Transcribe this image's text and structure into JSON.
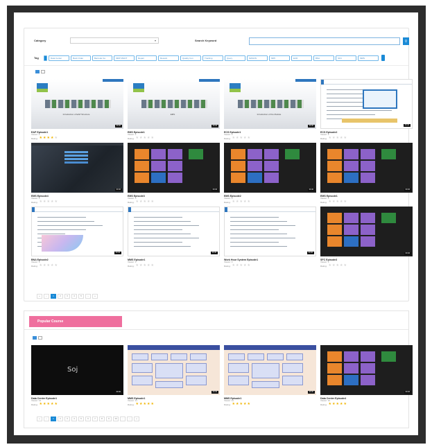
{
  "filter": {
    "category_label": "Category",
    "category_value": "",
    "search_label": "Search Keyword",
    "search_value": "",
    "tag_label": "Tag",
    "tags": [
      "Data Center",
      "Bock Order",
      "Barcode Ca",
      "MRP MGNT",
      "Repair",
      "Rework",
      "Quality Con",
      "Tracking",
      "Query",
      "MASON",
      "MPF",
      "ECR",
      "BNA",
      "SFC",
      "MMS"
    ]
  },
  "courses": [
    {
      "title": "EAP Episode1",
      "views": "Viewer: 4",
      "rating_label": "Rating:",
      "stars": 4,
      "thumb": "gallery",
      "caption": "Introduction of EAP Structure",
      "duration": "00:40"
    },
    {
      "title": "EMS Episode1",
      "views": "Viewer: 4",
      "rating_label": "Rating:",
      "stars": 0,
      "thumb": "gallery",
      "caption": "EMS",
      "duration": "00:40"
    },
    {
      "title": "ECS Episode1",
      "views": "Viewer: 3",
      "rating_label": "Rating:",
      "stars": 0,
      "thumb": "gallery",
      "caption": "Introduction of the Module",
      "duration": "00:40"
    },
    {
      "title": "ECS Episode2",
      "views": "Viewer: 3",
      "rating_label": "Rating:",
      "stars": 0,
      "thumb": "slide-diagram",
      "caption": "",
      "duration": "00:40"
    },
    {
      "title": "EMS Episode4",
      "views": "Viewer: 3",
      "rating_label": "Rating:",
      "stars": 0,
      "thumb": "dark",
      "caption": "",
      "duration": "00:40"
    },
    {
      "title": "EMS Episode3",
      "views": "Viewer: 3",
      "rating_label": "Rating:",
      "stars": 0,
      "thumb": "tiles",
      "caption": "",
      "duration": "00:40"
    },
    {
      "title": "EMS Episode2",
      "views": "Viewer: 3",
      "rating_label": "Rating:",
      "stars": 0,
      "thumb": "tiles",
      "caption": "",
      "duration": "00:40"
    },
    {
      "title": "EMS Episode1",
      "views": "Viewer: 3",
      "rating_label": "Rating:",
      "stars": 0,
      "thumb": "tiles",
      "caption": "",
      "duration": "00:40"
    },
    {
      "title": "BNA Episode2",
      "views": "Viewer: 3",
      "rating_label": "Rating:",
      "stars": 0,
      "thumb": "slide-chart",
      "caption": "",
      "duration": "00:40"
    },
    {
      "title": "MMS Episode1",
      "views": "Viewer: 3",
      "rating_label": "Rating:",
      "stars": 0,
      "thumb": "slide-text",
      "caption": "",
      "duration": "00:40"
    },
    {
      "title": "Work Hour System Episode1",
      "views": "Viewer: 3",
      "rating_label": "Rating:",
      "stars": 0,
      "thumb": "slide-text",
      "caption": "",
      "duration": "00:40"
    },
    {
      "title": "SFC Episode3",
      "views": "Viewer: 3",
      "rating_label": "Rating:",
      "stars": 0,
      "thumb": "tiles",
      "caption": "",
      "duration": "00:40"
    }
  ],
  "pager1": [
    "«",
    "‹",
    "1",
    "2",
    "3",
    "4",
    "5",
    "›",
    "»"
  ],
  "popular": {
    "banner": "Popular Course",
    "courses": [
      {
        "title": "Data Center Episode1",
        "views": "Viewer: 13",
        "rating_label": "Rating:",
        "stars": 5,
        "thumb": "black",
        "caption": "Soj",
        "duration": "00:40"
      },
      {
        "title": "MMS Episode1",
        "views": "Viewer: 11",
        "rating_label": "Rating:",
        "stars": 5,
        "thumb": "diagram",
        "caption": "",
        "duration": "00:40"
      },
      {
        "title": "MMS Episode1",
        "views": "Viewer: 11",
        "rating_label": "Rating:",
        "stars": 5,
        "thumb": "diagram",
        "caption": "",
        "duration": "00:40"
      },
      {
        "title": "Data Center Episode4",
        "views": "Viewer: 10",
        "rating_label": "Rating:",
        "stars": 5,
        "thumb": "tiles",
        "caption": "",
        "duration": "00:40"
      }
    ],
    "pager": [
      "«",
      "‹",
      "1",
      "2",
      "3",
      "4",
      "5",
      "6",
      "7",
      "8",
      "9",
      "10",
      "...",
      "›",
      "»"
    ]
  },
  "colors": {
    "accent": "#1a8ad6",
    "banner": "#ef6f9e",
    "star": "#f0b400"
  }
}
